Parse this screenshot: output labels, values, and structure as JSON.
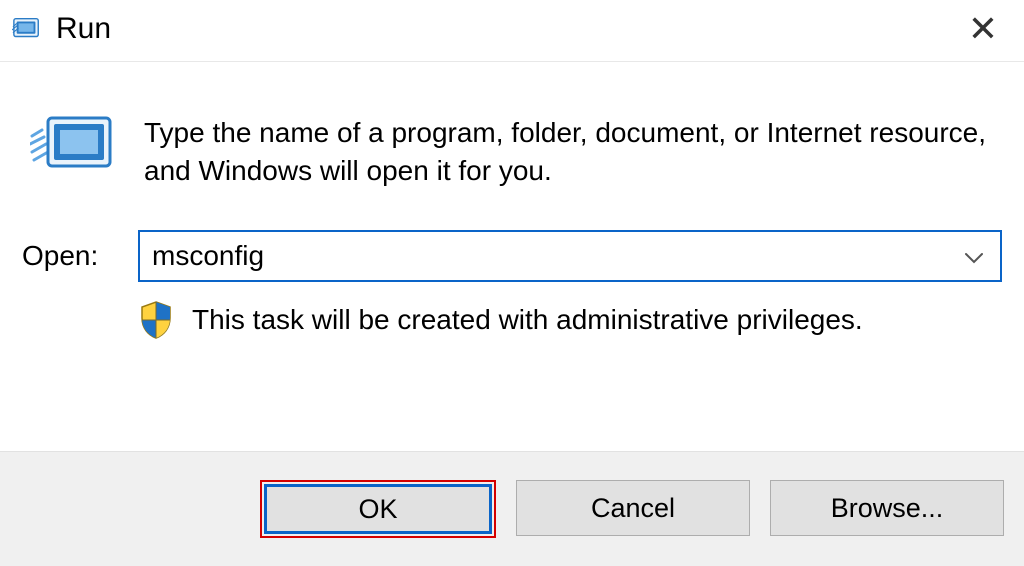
{
  "titlebar": {
    "title": "Run"
  },
  "main": {
    "instructions": "Type the name of a program, folder, document, or Internet resource, and Windows will open it for you.",
    "open_label": "Open:",
    "input_value": "msconfig",
    "admin_note": "This task will be created with administrative privileges."
  },
  "buttons": {
    "ok": "OK",
    "cancel": "Cancel",
    "browse": "Browse..."
  }
}
